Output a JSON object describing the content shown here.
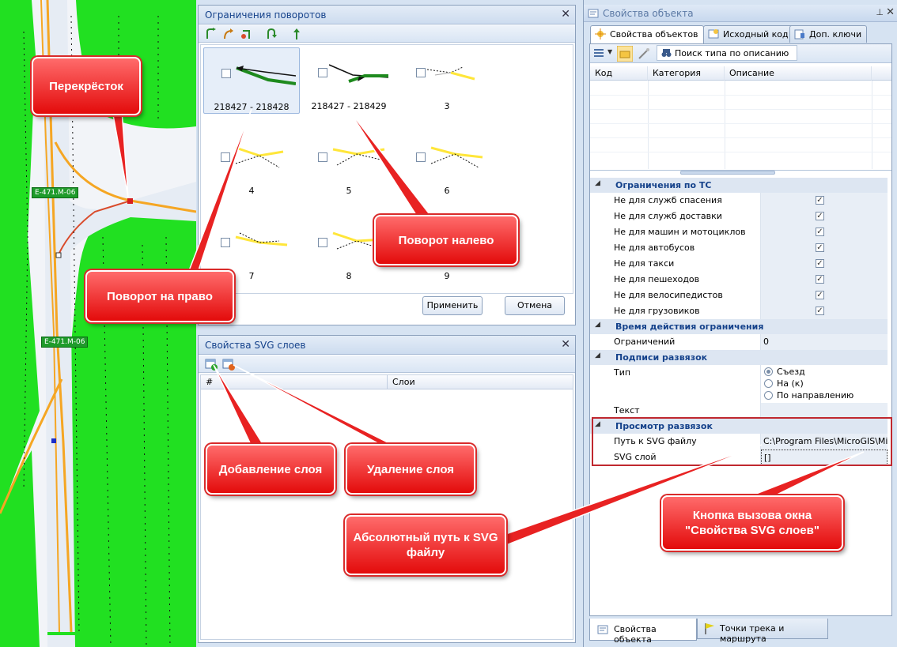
{
  "map": {
    "road_labels": [
      "E-471.M-06",
      "E-471.M-06"
    ]
  },
  "turn_panel": {
    "title": "Ограничения поворотов",
    "items": [
      {
        "label": "218427 - 218428"
      },
      {
        "label": "218427 - 218429"
      },
      {
        "label": "3"
      },
      {
        "label": "4"
      },
      {
        "label": "5"
      },
      {
        "label": "6"
      },
      {
        "label": "7"
      },
      {
        "label": "8"
      },
      {
        "label": "9"
      }
    ],
    "apply_label": "Применить",
    "cancel_label": "Отмена"
  },
  "svg_panel": {
    "title": "Свойства SVG слоев",
    "col_num": "#",
    "col_layers": "Слои"
  },
  "right_panel": {
    "title": "Свойства объекта",
    "tabs": [
      "Свойства объектов",
      "Исходный код",
      "Доп. ключи"
    ],
    "search_label": "Поиск типа по описанию",
    "grid_cols": [
      "Код",
      "Категория",
      "Описание"
    ],
    "cat_vehicle": "Ограничения по ТС",
    "vehicle_rows": [
      "Не для служб спасения",
      "Не для служб доставки",
      "Не для машин и мотоциклов",
      "Не для автобусов",
      "Не для такси",
      "Не для пешеходов",
      "Не для велосипедистов",
      "Не для грузовиков"
    ],
    "check_mark": "✓",
    "cat_time": "Время действия ограничения",
    "restrictions_label": "Ограничений",
    "restrictions_value": "0",
    "cat_captions": "Подписи развязок",
    "type_label": "Тип",
    "type_options": [
      "Съезд",
      "На (к)",
      "По направлению"
    ],
    "text_label": "Текст",
    "cat_view": "Просмотр развязок",
    "svg_path_label": "Путь к SVG файлу",
    "svg_path_value": "C:\\Program Files\\MicroGIS\\MicroG",
    "svg_layer_label": "SVG слой",
    "svg_layer_value": "[]",
    "bottom_tabs": [
      "Свойства объекта",
      "Точки трека и маршрута"
    ]
  },
  "callouts": {
    "intersection": "Перекрёсток",
    "turn_right": "Поворот на право",
    "turn_left": "Поворот налево",
    "add_layer": "Добавление слоя",
    "remove_layer": "Удаление слоя",
    "abs_path": "Абсолютный путь к SVG файлу",
    "svg_button": "Кнопка вызова окна \"Свойства SVG слоев\""
  }
}
